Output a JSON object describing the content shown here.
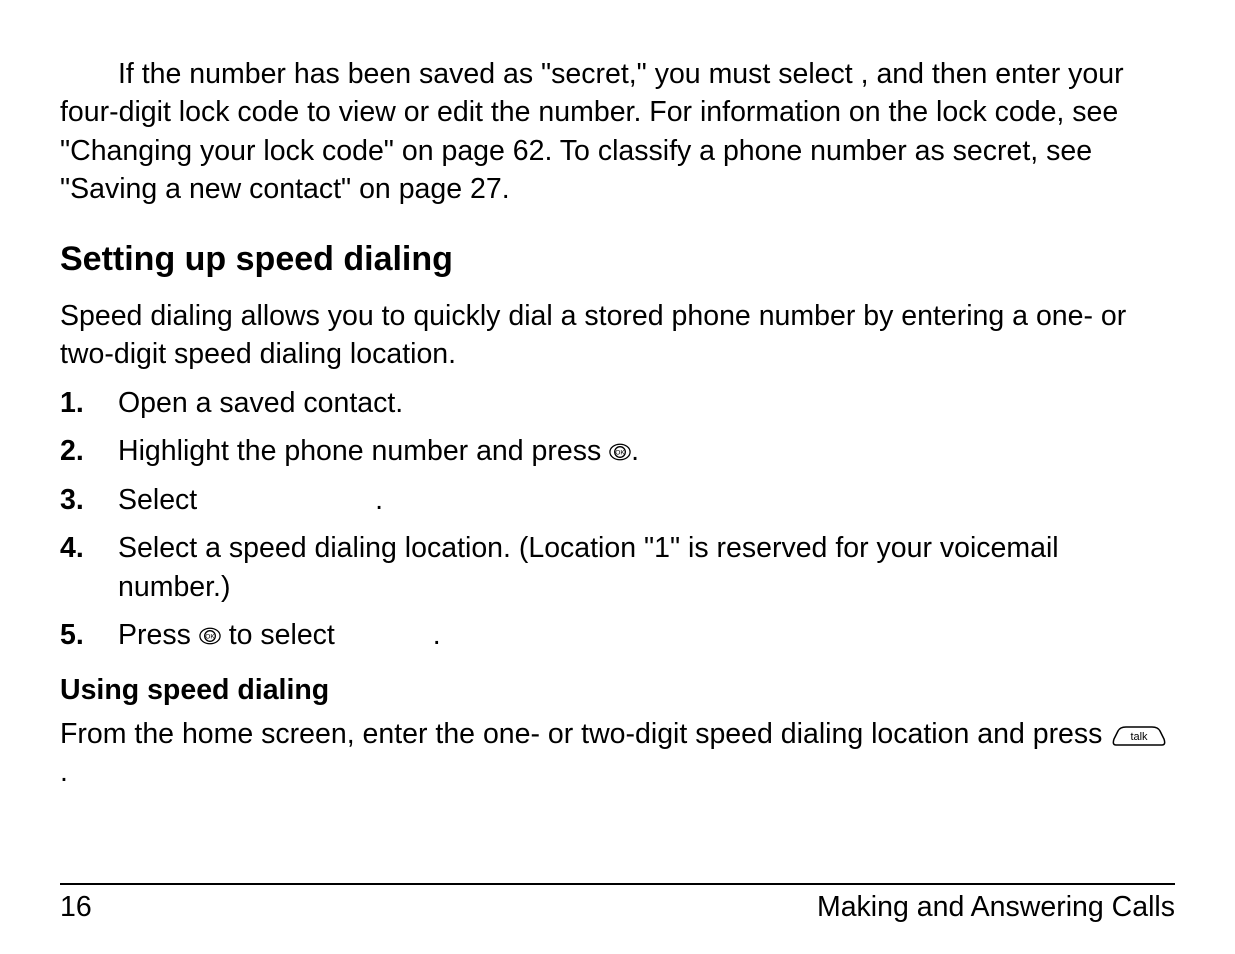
{
  "intro_para": "If the number has been saved as \"secret,\" you must select           , and then enter your four-digit lock code to view or edit the number. For information on the lock code, see \"Changing your lock code\" on page 62. To classify a phone number as secret, see \"Saving a new contact\" on page 27.",
  "heading": "Setting up speed dialing",
  "speed_para": "Speed dialing allows you to quickly dial a stored phone number by entering a one- or two-digit speed dialing location.",
  "steps": {
    "s1": "Open a saved contact.",
    "s2a": "Highlight the phone number and press ",
    "s2b": ".",
    "s3a": "Select ",
    "s3b": ".",
    "s4": "Select a speed dialing location. (Location \"1\" is reserved for your voicemail number.)",
    "s5a": "Press ",
    "s5b": " to select ",
    "s5c": "."
  },
  "subhead": "Using speed dialing",
  "using_a": "From the home screen, enter the one- or two-digit speed dialing location and press ",
  "using_b": ".",
  "footer": {
    "page_number": "16",
    "chapter": "Making and Answering Calls"
  }
}
